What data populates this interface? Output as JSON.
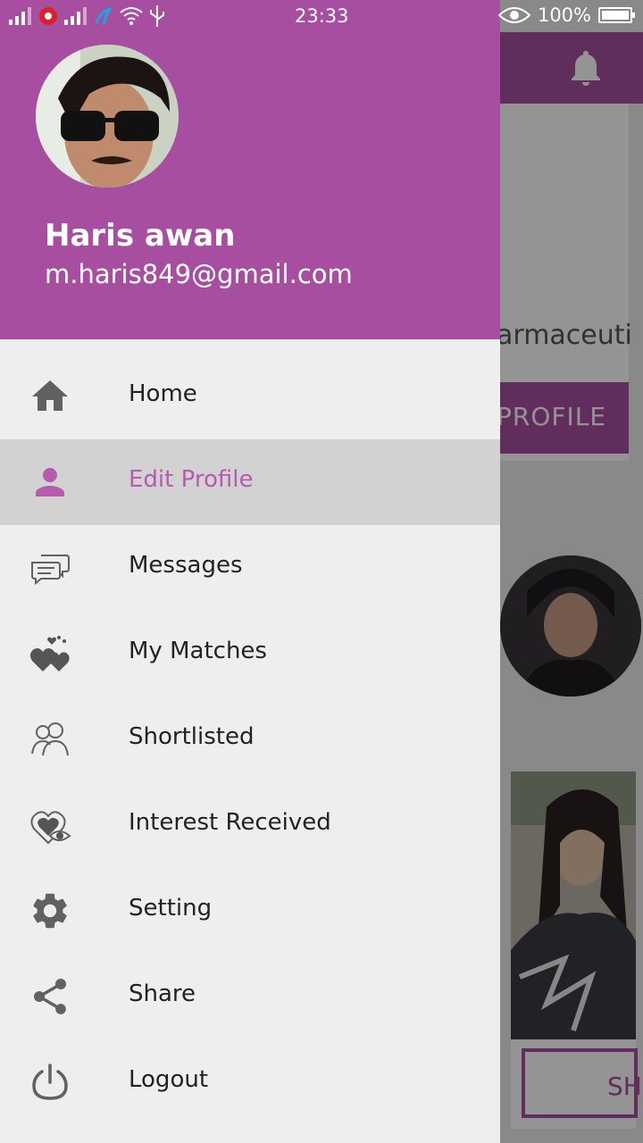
{
  "status_bar": {
    "time": "23:33",
    "battery_percent": "100%",
    "icons": [
      "signal-icon",
      "notification-icon",
      "signal-icon",
      "carrier-icon",
      "wifi-icon",
      "usb-icon",
      "eye-icon",
      "battery-icon"
    ]
  },
  "background_app": {
    "card_text": "armaceuti",
    "profile_button": "PROFILE",
    "second_button": "SH",
    "accent_color": "#a74ea0"
  },
  "drawer": {
    "header_color": "#a84ea0",
    "user_name": "Haris awan",
    "user_email": "m.haris849@gmail.com",
    "items": [
      {
        "label": "Home",
        "icon": "home-icon",
        "active": false
      },
      {
        "label": "Edit Profile",
        "icon": "person-icon",
        "active": true
      },
      {
        "label": "Messages",
        "icon": "chat-bubbles-icon",
        "active": false
      },
      {
        "label": "My Matches",
        "icon": "hearts-icon",
        "active": false
      },
      {
        "label": "Shortlisted",
        "icon": "people-icon",
        "active": false
      },
      {
        "label": "Interest Received",
        "icon": "heart-eye-icon",
        "active": false
      },
      {
        "label": "Setting",
        "icon": "gear-icon",
        "active": false
      },
      {
        "label": "Share",
        "icon": "share-icon",
        "active": false
      },
      {
        "label": "Logout",
        "icon": "power-icon",
        "active": false
      }
    ]
  }
}
